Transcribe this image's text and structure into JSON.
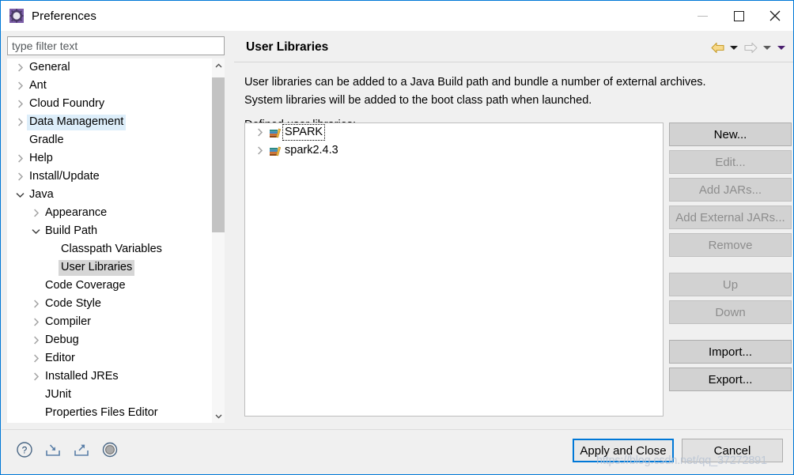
{
  "window": {
    "title": "Preferences",
    "icon": "gear-icon",
    "controls": {
      "minimize": "–",
      "maximize": "□",
      "close": "✕"
    }
  },
  "filter": {
    "placeholder": "type filter text",
    "value": ""
  },
  "tree": [
    {
      "label": "General",
      "depth": 0,
      "twisty": "collapsed",
      "state": "normal"
    },
    {
      "label": "Ant",
      "depth": 0,
      "twisty": "collapsed",
      "state": "normal"
    },
    {
      "label": "Cloud Foundry",
      "depth": 0,
      "twisty": "collapsed",
      "state": "normal"
    },
    {
      "label": "Data Management",
      "depth": 0,
      "twisty": "collapsed",
      "state": "hovered"
    },
    {
      "label": "Gradle",
      "depth": 0,
      "twisty": "none",
      "state": "normal"
    },
    {
      "label": "Help",
      "depth": 0,
      "twisty": "collapsed",
      "state": "normal"
    },
    {
      "label": "Install/Update",
      "depth": 0,
      "twisty": "collapsed",
      "state": "normal"
    },
    {
      "label": "Java",
      "depth": 0,
      "twisty": "expanded",
      "state": "normal"
    },
    {
      "label": "Appearance",
      "depth": 1,
      "twisty": "collapsed",
      "state": "normal"
    },
    {
      "label": "Build Path",
      "depth": 1,
      "twisty": "expanded",
      "state": "normal"
    },
    {
      "label": "Classpath Variables",
      "depth": 2,
      "twisty": "none",
      "state": "normal"
    },
    {
      "label": "User Libraries",
      "depth": 2,
      "twisty": "none",
      "state": "selected"
    },
    {
      "label": "Code Coverage",
      "depth": 1,
      "twisty": "none",
      "state": "normal"
    },
    {
      "label": "Code Style",
      "depth": 1,
      "twisty": "collapsed",
      "state": "normal"
    },
    {
      "label": "Compiler",
      "depth": 1,
      "twisty": "collapsed",
      "state": "normal"
    },
    {
      "label": "Debug",
      "depth": 1,
      "twisty": "collapsed",
      "state": "normal"
    },
    {
      "label": "Editor",
      "depth": 1,
      "twisty": "collapsed",
      "state": "normal"
    },
    {
      "label": "Installed JREs",
      "depth": 1,
      "twisty": "collapsed",
      "state": "normal"
    },
    {
      "label": "JUnit",
      "depth": 1,
      "twisty": "none",
      "state": "normal"
    },
    {
      "label": "Properties Files Editor",
      "depth": 1,
      "twisty": "none",
      "state": "normal"
    }
  ],
  "page": {
    "title": "User Libraries",
    "description_line1": "User libraries can be added to a Java Build path and bundle a number of external archives.",
    "description_line2": "System libraries will be added to the boot class path when launched.",
    "list_label": "Defined user libraries:",
    "nav": {
      "back": "back-arrow-icon",
      "back_menu": "back-dropdown-icon",
      "forward": "forward-arrow-icon",
      "forward_menu": "forward-dropdown-icon",
      "view_menu": "view-menu-dropdown-icon"
    }
  },
  "libraries": [
    {
      "name": "SPARK",
      "icon": "library-books-icon",
      "twisty": "collapsed",
      "focused": true
    },
    {
      "name": "spark2.4.3",
      "icon": "library-books-icon",
      "twisty": "collapsed",
      "focused": false
    }
  ],
  "side_buttons": [
    {
      "label": "New...",
      "enabled": true,
      "spacer_after": "sm"
    },
    {
      "label": "Edit...",
      "enabled": false,
      "spacer_after": "sm"
    },
    {
      "label": "Add JARs...",
      "enabled": false,
      "spacer_after": "sm"
    },
    {
      "label": "Add External JARs...",
      "enabled": false,
      "spacer_after": "sm"
    },
    {
      "label": "Remove",
      "enabled": false,
      "spacer_after": "lg"
    },
    {
      "label": "Up",
      "enabled": false,
      "spacer_after": "sm"
    },
    {
      "label": "Down",
      "enabled": false,
      "spacer_after": "lg"
    },
    {
      "label": "Import...",
      "enabled": true,
      "spacer_after": "sm"
    },
    {
      "label": "Export...",
      "enabled": true,
      "spacer_after": "sm"
    }
  ],
  "bottom": {
    "icons": [
      "help-icon",
      "import-preferences-icon",
      "export-preferences-icon",
      "restore-defaults-icon"
    ],
    "apply_label": "Apply and Close",
    "cancel_label": "Cancel"
  },
  "watermark": "https://blog.csdn.net/qq_37272891",
  "colors": {
    "accent": "#0078d7",
    "selection": "#d6d6d6",
    "hover": "#ddeefa",
    "dialog_bg": "#f0f0f0",
    "button_bg": "#d2d2d2",
    "back_arrow": "#e8b33c"
  }
}
